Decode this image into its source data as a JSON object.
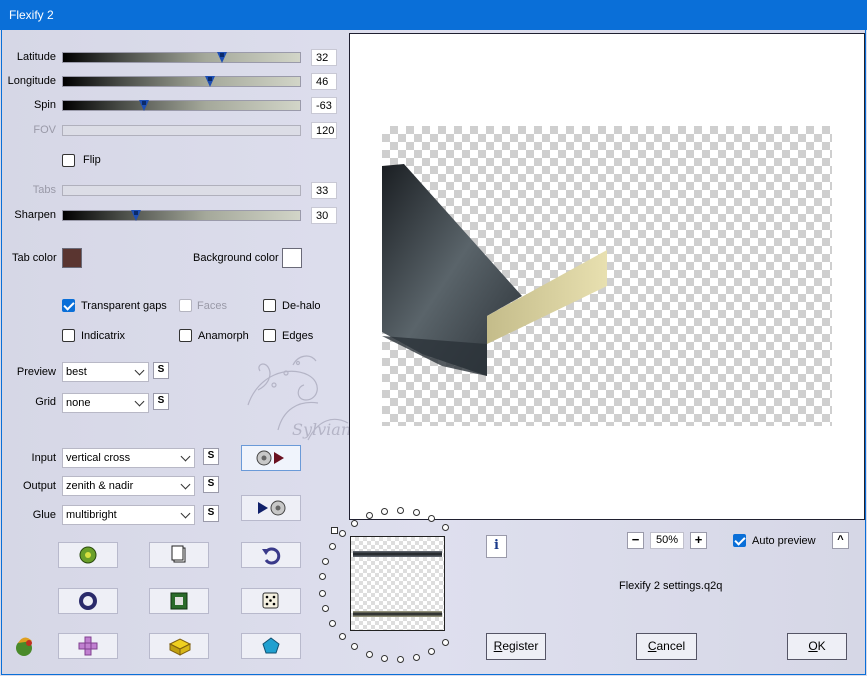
{
  "window": {
    "title": "Flexify 2"
  },
  "sliders": [
    {
      "label": "Latitude",
      "value": "32",
      "level": 0.67,
      "enabled": true
    },
    {
      "label": "Longitude",
      "value": "46",
      "level": 0.62,
      "enabled": true
    },
    {
      "label": "Spin",
      "value": "-63",
      "level": 0.34,
      "enabled": true
    },
    {
      "label": "FOV",
      "value": "120",
      "level": null,
      "enabled": false
    },
    {
      "label": "Tabs",
      "value": "33",
      "level": null,
      "enabled": false
    },
    {
      "label": "Sharpen",
      "value": "30",
      "level": 0.31,
      "enabled": true
    }
  ],
  "flip": {
    "label": "Flip",
    "checked": false
  },
  "colors": {
    "tab_label": "Tab color",
    "tab_value": "#5a3530",
    "bg_label": "Background color",
    "bg_value": "#ffffff",
    "accent": "#0a6fd8"
  },
  "options": {
    "transparent_gaps": {
      "label": "Transparent gaps",
      "checked": true
    },
    "faces": {
      "label": "Faces",
      "checked": false,
      "enabled": false
    },
    "de_halo": {
      "label": "De-halo",
      "checked": false
    },
    "indicatrix": {
      "label": "Indicatrix",
      "checked": false
    },
    "anamorph": {
      "label": "Anamorph",
      "checked": false
    },
    "edges": {
      "label": "Edges",
      "checked": false
    }
  },
  "preview_select": {
    "label": "Preview",
    "value": "best"
  },
  "grid_select": {
    "label": "Grid",
    "value": "none"
  },
  "input_select": {
    "label": "Input",
    "value": "vertical cross"
  },
  "output_select": {
    "label": "Output",
    "value": "zenith & nadir"
  },
  "glue_select": {
    "label": "Glue",
    "value": "multibright"
  },
  "s_button": "S",
  "watermark": "Sylviane",
  "zoom": {
    "value": "50%",
    "minus": "−",
    "plus": "+"
  },
  "auto_preview": {
    "label": "Auto preview",
    "checked": true
  },
  "collapse_glyph": "^",
  "info_glyph": "i",
  "settings_file": "Flexify 2 settings.q2q",
  "buttons": {
    "register_prefix": "R",
    "register_rest": "egister",
    "cancel_prefix": "C",
    "cancel_rest": "ancel",
    "ok_prefix": "O",
    "ok_rest": "K"
  },
  "icons": [
    "play-to-globe-icon",
    "globe-to-play-icon",
    "randomize-globe-icon",
    "new-page-icon",
    "undo-icon",
    "ring-icon",
    "square-frame-icon",
    "dice-icon",
    "filter-plant-icon",
    "cross-pattern-icon",
    "lego-brick-icon",
    "pentagon-gem-icon"
  ]
}
